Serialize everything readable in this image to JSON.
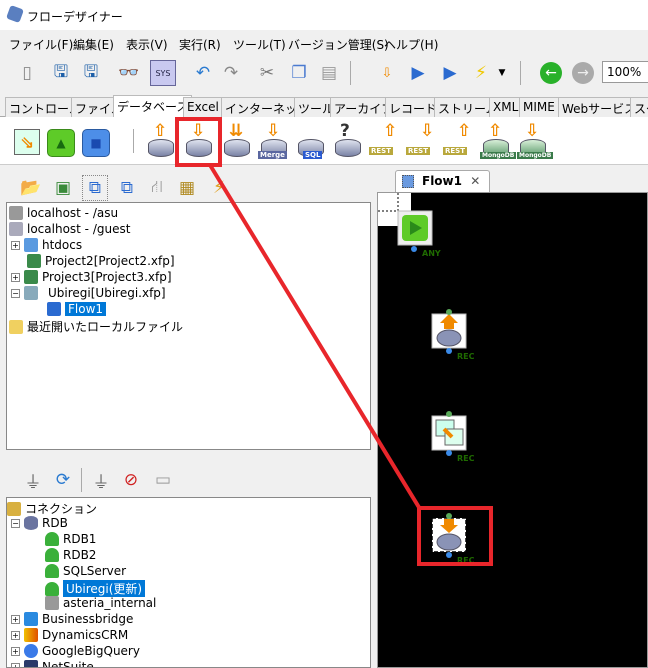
{
  "window": {
    "title": "フローデザイナー"
  },
  "menu": [
    "ファイル(F)",
    "編集(E)",
    "表示(V)",
    "実行(R)",
    "ツール(T)",
    "バージョン管理(S)",
    "ヘルプ(H)"
  ],
  "toolbar": {
    "zoom": "100%"
  },
  "palette_tabs": [
    "コントロール",
    "ファイル",
    "データベース",
    "Excel",
    "インターネット",
    "ツール",
    "アーカイブ",
    "レコード",
    "ストリーム",
    "XML",
    "MIME",
    "Webサービス",
    "スケ"
  ],
  "active_tab": "データベース",
  "db_components": {
    "merge": "Merge",
    "sql": "SQL",
    "rest": "REST",
    "mongodb": "MongoDB"
  },
  "project_tree": {
    "items": [
      "localhost - /asu",
      "localhost - /guest",
      "htdocs",
      "Project2[Project2.xfp]",
      "Project3[Project3.xfp]",
      "Ubiregi[Ubiregi.xfp]",
      "Flow1",
      "最近開いたローカルファイル"
    ]
  },
  "connection_tree": {
    "root": "コネクション",
    "rdb": "RDB",
    "rdb_items": [
      "RDB1",
      "RDB2",
      "SQLServer",
      "Ubiregi(更新)",
      "asteria_internal"
    ],
    "others": [
      "Businessbridge",
      "DynamicsCRM",
      "GoogleBigQuery",
      "NetSuite"
    ]
  },
  "canvas": {
    "tab": "Flow1",
    "ports": {
      "any": "ANY",
      "rec": "REC"
    }
  },
  "colors": {
    "highlight": "#e8262b",
    "selection": "#0078d7"
  }
}
